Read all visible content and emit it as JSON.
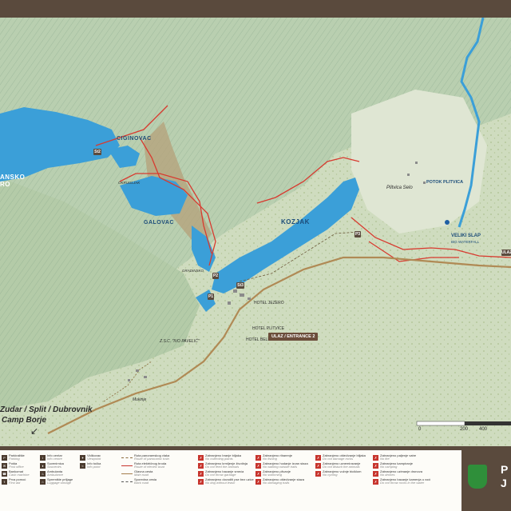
{
  "map": {
    "lakes": {
      "left_lake": "ANSKO\nRO",
      "ciginovac": "CIGINOVAC",
      "galovac": "GALOVAC",
      "kozjak": "KOZJAK"
    },
    "places": {
      "okrugljak": "OKRUGLJAK",
      "gradinsko": "GRADINSKO",
      "plitvica_selo": "Plitvica Selo",
      "potok_plitvica": "POTOK PLITVICA",
      "veliki_slap": "VELIKI SLAP",
      "big_waterfall": "BIG WATERFALL",
      "hotel_jezero": "HOTEL JEZERO",
      "hotel_plitvice": "HOTEL PLITVICE",
      "hotel_bellevue": "HOTEL BELLEVUE",
      "zsc_ivo_pavelic": "Z.S.C. \"IVO PAVELIĆ\"",
      "mukinje": "Mukinje",
      "zudar_split_dubrovnik": "Zudar / Split / Dubrovnik",
      "camp_borje": "Camp Borje"
    },
    "entrance": "ULAZ / ENTRANCE 2",
    "codes": {
      "st2": "St2",
      "st3": "St3",
      "p1": "P1",
      "p2": "P2",
      "p3": "P3",
      "sul": "ULAZ"
    },
    "scale": {
      "zero": "0",
      "two_hundred": "200",
      "four_hundred": "400"
    }
  },
  "legend": {
    "col1": [
      {
        "icon": "P",
        "label": "Parkiralište",
        "sub": "Parking"
      },
      {
        "icon": "✉",
        "label": "Pošta",
        "sub": "Post office"
      },
      {
        "icon": "☎",
        "label": "Bankomat",
        "sub": "Cash machine"
      },
      {
        "icon": "⚕",
        "label": "Prva pomoć",
        "sub": "First aid"
      }
    ],
    "col2": [
      {
        "icon": "i",
        "label": "Info centar",
        "sub": "Info centre"
      },
      {
        "icon": "♦",
        "label": "Suvenirnica",
        "sub": "Souvenirs"
      },
      {
        "icon": "♨",
        "label": "Ambulanta",
        "sub": "Ambulance"
      },
      {
        "icon": "⌂",
        "label": "Spremište prtljage",
        "sub": "Luggage storage"
      }
    ],
    "col3": [
      {
        "icon": "✦",
        "label": "Vidikovac",
        "sub": "Viewpoint"
      },
      {
        "icon": "≈",
        "label": "Info točka",
        "sub": "Info point"
      }
    ],
    "col4": [
      {
        "line": "dashed",
        "label": "Ruta panoramskog vlaka",
        "sub": "Route of panoramic train"
      },
      {
        "line": "red",
        "label": "Ruta električnog broda",
        "sub": "Route of electric boat"
      },
      {
        "line": "brown",
        "label": "Glavna cesta",
        "sub": "Main road"
      },
      {
        "line": "dark",
        "label": "Sporedna cesta",
        "sub": "Back road"
      }
    ],
    "col5": [
      {
        "icon": "✗",
        "label": "Zabranjeno branje biljaka",
        "sub": "No collecting plants"
      },
      {
        "icon": "✗",
        "label": "Zabranjeno krmljenje životinja",
        "sub": "Do not feed the animals"
      },
      {
        "icon": "✗",
        "label": "Zabranjeno bacanje smeća",
        "sub": "Do not throw garbage"
      },
      {
        "icon": "✗",
        "label": "Zabranjeno dovoditi pse bez uzice",
        "sub": "No dog without leash"
      }
    ],
    "col6": [
      {
        "icon": "✗",
        "label": "Zabranjeno ribarenje",
        "sub": "No fishing"
      },
      {
        "icon": "✗",
        "label": "Zabranjeno hodanje izvan staza",
        "sub": "No walking outside trails"
      },
      {
        "icon": "✗",
        "label": "Zabranjeno plivanje",
        "sub": "No swimming"
      },
      {
        "icon": "✗",
        "label": "Zabranjeno oštećivanje staza",
        "sub": "No damaging trails"
      }
    ],
    "col7": [
      {
        "icon": "✗",
        "label": "Zabranjeno oštećivanje biljaka",
        "sub": "Do not damage rocks"
      },
      {
        "icon": "✗",
        "label": "Zabranjeno uznemiravanje",
        "sub": "Do not disturb the animals"
      },
      {
        "icon": "✗",
        "label": "Zabranjeno vožnje biciklom",
        "sub": "No cycling"
      }
    ],
    "col8": [
      {
        "icon": "✗",
        "label": "Zabranjeno paljenje vatre",
        "sub": "No fire"
      },
      {
        "icon": "✗",
        "label": "Zabranjeno kampiranje",
        "sub": "No camping"
      },
      {
        "icon": "✗",
        "label": "Zabranjeno uzimanje dronova",
        "sub": "No drones"
      },
      {
        "icon": "✗",
        "label": "Zabranjeno bacanje kamenja u vode",
        "sub": "Do not throw rocks in the water"
      }
    ]
  },
  "logo": {
    "letter1": "P",
    "letter2": "J"
  },
  "colors": {
    "frame": "#5a4a3d",
    "water": "#3b9fd8",
    "terrain": "#c8d6b8",
    "trail": "#d83a2f",
    "road": "#b08a55"
  }
}
